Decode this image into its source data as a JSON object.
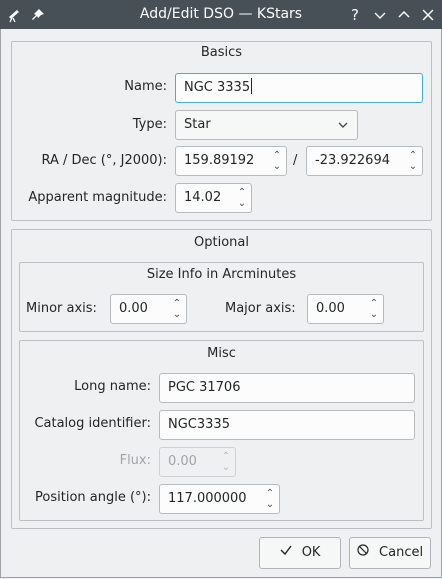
{
  "window": {
    "title": "Add/Edit DSO — KStars"
  },
  "basics": {
    "title": "Basics",
    "name_label": "Name:",
    "name_value": "NGC 3335",
    "type_label": "Type:",
    "type_value": "Star",
    "radec_label": "RA / Dec (°, J2000):",
    "ra_value": "159.89192",
    "separator": "/",
    "dec_value": "-23.922694",
    "mag_label": "Apparent magnitude:",
    "mag_value": "14.02"
  },
  "optional": {
    "title": "Optional",
    "size": {
      "title": "Size Info in Arcminutes",
      "minor_label": "Minor axis:",
      "minor_value": "0.00",
      "major_label": "Major axis:",
      "major_value": "0.00"
    },
    "misc": {
      "title": "Misc",
      "long_name_label": "Long name:",
      "long_name_value": "PGC 31706",
      "catalog_id_label": "Catalog identifier:",
      "catalog_id_value": "NGC3335",
      "flux_label": "Flux:",
      "flux_value": "0.00",
      "position_angle_label": "Position angle (°):",
      "position_angle_value": "117.000000"
    }
  },
  "buttons": {
    "ok": "OK",
    "cancel": "Cancel"
  },
  "icons": {
    "app": "telescope-icon",
    "pin": "pin-icon",
    "help": "help-icon",
    "minimize": "minimize-icon",
    "maximize": "maximize-icon",
    "close": "close-icon",
    "ok": "checkmark-icon",
    "cancel": "cancel-icon"
  },
  "colors": {
    "titlebar": "#475057",
    "focus": "#3daee9",
    "window_bg": "#eff0f1"
  }
}
